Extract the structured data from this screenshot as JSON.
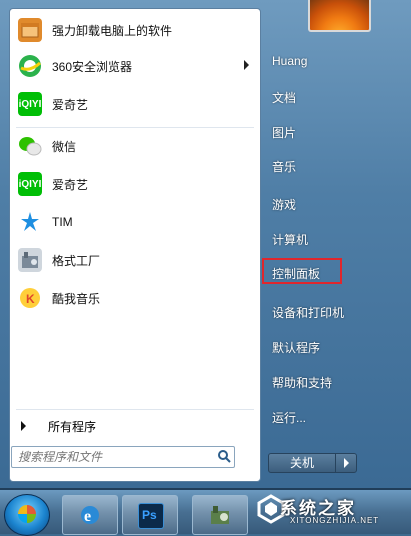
{
  "start_menu": {
    "pinned": [
      {
        "label": "强力卸载电脑上的软件",
        "icon": "uninstall-box-icon",
        "color": "#e08a2c",
        "has_submenu": false
      },
      {
        "label": "360安全浏览器",
        "icon": "360-browser-icon",
        "color": "#2bb24c",
        "has_submenu": true
      },
      {
        "label": "爱奇艺",
        "icon": "iqiyi-icon",
        "color": "#00be06",
        "has_submenu": false
      }
    ],
    "recent": [
      {
        "label": "微信",
        "icon": "wechat-icon",
        "color": "#2dc100"
      },
      {
        "label": "爱奇艺",
        "icon": "iqiyi-icon",
        "color": "#00be06"
      },
      {
        "label": "TIM",
        "icon": "tim-icon",
        "color": "#1e8fe1"
      },
      {
        "label": "格式工厂",
        "icon": "format-factory-icon",
        "color": "#7b8a99"
      },
      {
        "label": "酷我音乐",
        "icon": "kuwo-music-icon",
        "color": "#f5a623"
      }
    ],
    "all_programs": "所有程序",
    "search_placeholder": "搜索程序和文件",
    "right_items": [
      {
        "label": "Huang",
        "name": "user-folder"
      },
      {
        "label": "文档",
        "name": "documents"
      },
      {
        "label": "图片",
        "name": "pictures"
      },
      {
        "label": "音乐",
        "name": "music"
      },
      {
        "label": "游戏",
        "name": "games"
      },
      {
        "label": "计算机",
        "name": "computer"
      },
      {
        "label": "控制面板",
        "name": "control-panel"
      },
      {
        "label": "设备和打印机",
        "name": "devices-and-printers"
      },
      {
        "label": "默认程序",
        "name": "default-programs"
      },
      {
        "label": "帮助和支持",
        "name": "help-and-support"
      },
      {
        "label": "运行...",
        "name": "run"
      }
    ],
    "shutdown_label": "关机",
    "highlight_color": "#e0262c"
  },
  "taskbar": {
    "buttons": [
      {
        "name": "ie-taskbar-button",
        "icon": "internet-explorer-icon",
        "color": "#2a8ad6"
      },
      {
        "name": "photoshop-taskbar-button",
        "icon": "photoshop-icon",
        "color": "#0b2a4a",
        "text": "Ps"
      },
      {
        "name": "format-factory-taskbar-button",
        "icon": "format-factory-icon",
        "color": "#5a7f4a"
      }
    ]
  },
  "watermark": {
    "text": "系统之家",
    "url": "XITONGZHIJIA.NET"
  }
}
